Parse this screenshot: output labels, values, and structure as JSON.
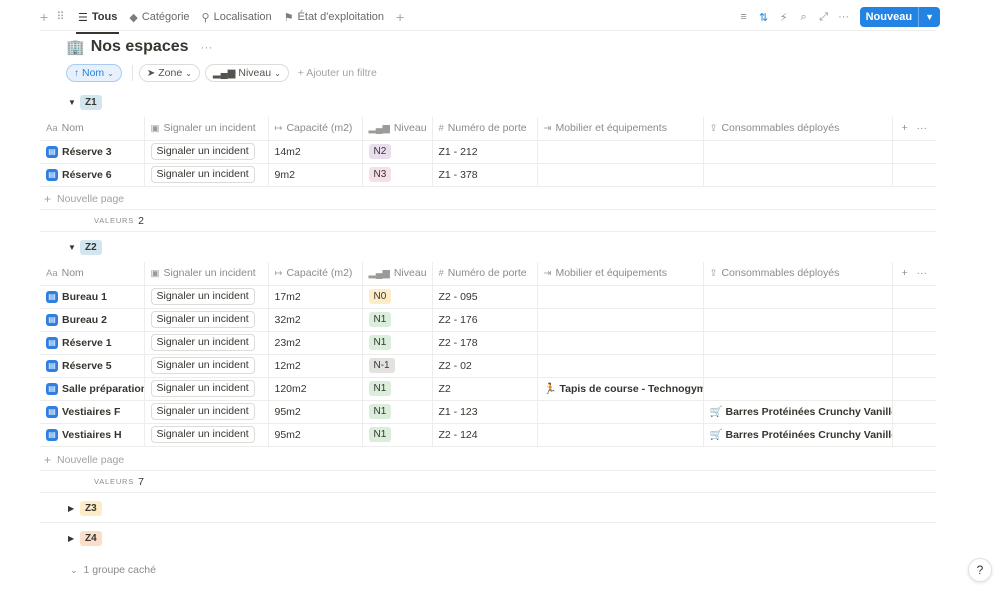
{
  "viewbar": {
    "tabs": [
      {
        "label": "Tous",
        "icon": "list-icon"
      },
      {
        "label": "Catégorie",
        "icon": "tag-icon"
      },
      {
        "label": "Localisation",
        "icon": "pin-icon"
      },
      {
        "label": "État d'exploitation",
        "icon": "flag-icon"
      }
    ],
    "new_label": "Nouveau"
  },
  "page": {
    "emoji": "🏢",
    "title": "Nos espaces"
  },
  "filters": {
    "sort_label": "Nom",
    "zone_label": "Zone",
    "niveau_label": "Niveau",
    "add_filter": "Ajouter un filtre"
  },
  "columns": [
    {
      "label": "Nom",
      "icon": "Aa"
    },
    {
      "label": "Signaler un incident",
      "icon": "button-icon"
    },
    {
      "label": "Capacité (m2)",
      "icon": "formula-icon"
    },
    {
      "label": "Niveau",
      "icon": "bars-icon"
    },
    {
      "label": "Numéro de porte",
      "icon": "#"
    },
    {
      "label": "Mobilier et équipements",
      "icon": "relation-icon"
    },
    {
      "label": "Consommables déployés",
      "icon": "relation-icon"
    }
  ],
  "button_label": "Signaler un incident",
  "new_page_label": "Nouvelle page",
  "summary_label": "VALEURS",
  "groups": [
    {
      "name": "Z1",
      "count": "2",
      "rows": [
        {
          "name": "Réserve 3",
          "cap": "14m2",
          "niveau": "N2",
          "porte": "Z1 - 212",
          "mobilier": "",
          "conso": ""
        },
        {
          "name": "Réserve 6",
          "cap": "9m2",
          "niveau": "N3",
          "porte": "Z1 - 378",
          "mobilier": "",
          "conso": ""
        }
      ]
    },
    {
      "name": "Z2",
      "count": "7",
      "rows": [
        {
          "name": "Bureau 1",
          "cap": "17m2",
          "niveau": "N0",
          "porte": "Z2 - 095",
          "mobilier": "",
          "conso": ""
        },
        {
          "name": "Bureau 2",
          "cap": "32m2",
          "niveau": "N1",
          "porte": "Z2 - 176",
          "mobilier": "",
          "conso": ""
        },
        {
          "name": "Réserve 1",
          "cap": "23m2",
          "niveau": "N1",
          "porte": "Z2 - 178",
          "mobilier": "",
          "conso": ""
        },
        {
          "name": "Réserve 5",
          "cap": "12m2",
          "niveau": "N-1",
          "porte": "Z2 - 02",
          "mobilier": "",
          "conso": ""
        },
        {
          "name": "Salle préparation p",
          "cap": "120m2",
          "niveau": "N1",
          "porte": "Z2",
          "mobilier": "🏃 Tapis de course - Technogym",
          "conso": ""
        },
        {
          "name": "Vestiaires F",
          "cap": "95m2",
          "niveau": "N1",
          "porte": "Z1 - 123",
          "mobilier": "",
          "conso": "🛒 Barres Protéinées Crunchy Vanille 🛒"
        },
        {
          "name": "Vestiaires H",
          "cap": "95m2",
          "niveau": "N1",
          "porte": "Z2 - 124",
          "mobilier": "",
          "conso": "🛒 Barres Protéinées Crunchy Vanille 🛒"
        }
      ]
    }
  ],
  "collapsed_groups": [
    "Z3",
    "Z4"
  ],
  "hidden_groups_label": "1 groupe caché",
  "colors": {
    "accent": "#2383e2",
    "niveau_N0": "#fdecc8",
    "niveau_N1": "#dbeddb",
    "niveau_N2": "#e8deee",
    "niveau_N3": "#f5e0e9",
    "niveau_Nm1": "#e3e2e0"
  }
}
